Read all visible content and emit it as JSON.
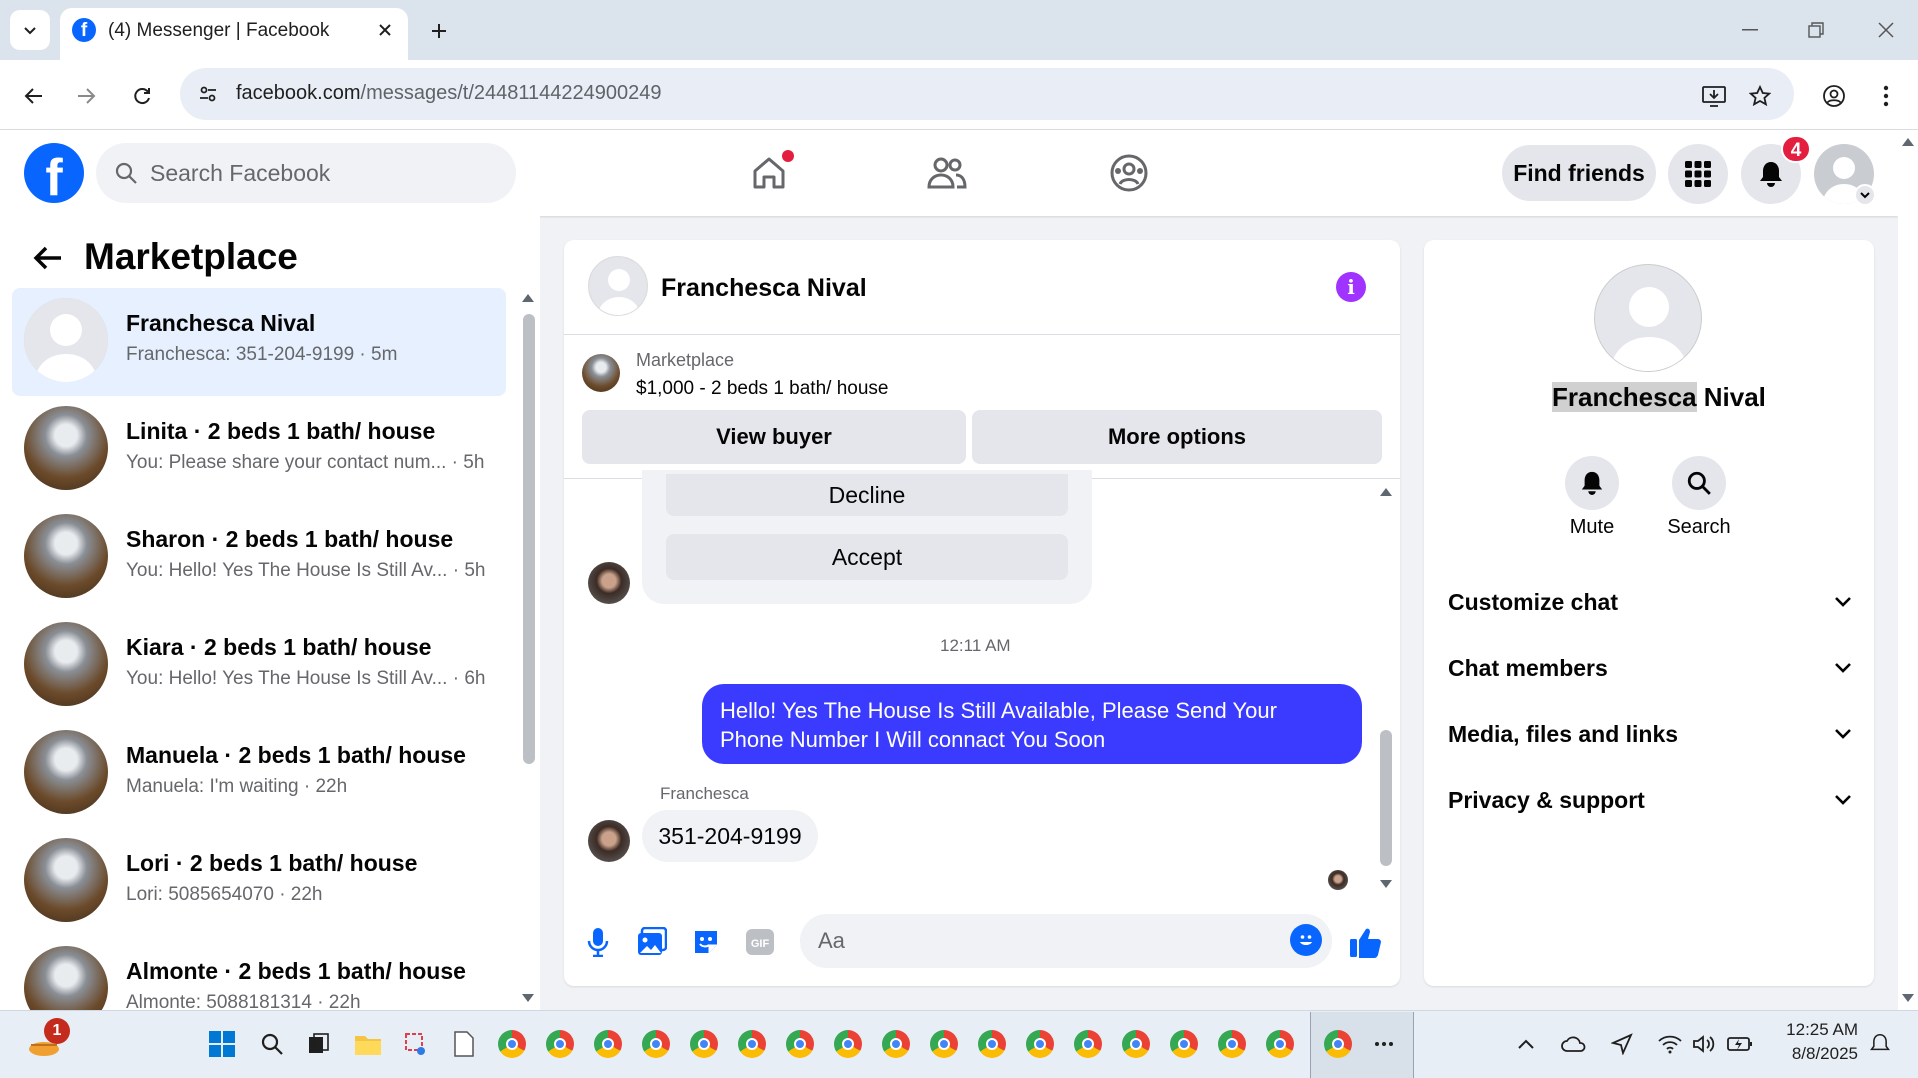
{
  "browser": {
    "tab_title": "(4) Messenger | Facebook",
    "url_domain": "facebook.com",
    "url_path": "/messages/t/24481144224900249"
  },
  "header": {
    "search_placeholder": "Search Facebook",
    "find_friends_label": "Find friends",
    "notification_count": "4"
  },
  "left": {
    "title": "Marketplace",
    "conversations": [
      {
        "name": "Franchesca Nival",
        "preview": "Franchesca: 351-204-9199 · 5m",
        "avatar": "default-avatar"
      },
      {
        "name": "Linita · 2 beds 1 bath/ house",
        "preview": "You: Please share your contact num... · 5h",
        "avatar": "listing-photo"
      },
      {
        "name": "Sharon · 2 beds 1 bath/ house",
        "preview": "You: Hello! Yes The House Is Still Av... · 5h",
        "avatar": "listing-photo"
      },
      {
        "name": "Kiara · 2 beds 1 bath/ house",
        "preview": "You: Hello! Yes The House Is Still Av... · 6h",
        "avatar": "listing-photo"
      },
      {
        "name": "Manuela · 2 beds 1 bath/ house",
        "preview": "Manuela: I'm waiting · 22h",
        "avatar": "listing-photo"
      },
      {
        "name": "Lori · 2 beds 1 bath/ house",
        "preview": "Lori: 5085654070 · 22h",
        "avatar": "listing-photo"
      },
      {
        "name": "Almonte · 2 beds 1 bath/ house",
        "preview": "Almonte: 5088181314 · 22h",
        "avatar": "listing-photo"
      }
    ]
  },
  "chat": {
    "title": "Franchesca Nival",
    "listing_label": "Marketplace",
    "listing_title": "$1,000 - 2 beds 1 bath/ house",
    "view_buyer_label": "View buyer",
    "more_options_label": "More options",
    "decline_label": "Decline",
    "accept_label": "Accept",
    "timestamp": "12:11 AM",
    "outgoing_message": "Hello! Yes The House  Is Still Available, Please Send Your Phone Number I Will connact You Soon",
    "incoming_sender": "Franchesca",
    "incoming_message": "351-204-9199",
    "composer_placeholder": "Aa",
    "accent_color": "#3a3bff"
  },
  "right": {
    "name_first": "Franchesca",
    "name_last": " Nival",
    "mute_label": "Mute",
    "search_label": "Search",
    "sections": [
      "Customize chat",
      "Chat members",
      "Media, files and links",
      "Privacy & support"
    ]
  },
  "taskbar": {
    "badge_count": "1",
    "time": "12:25 AM",
    "date": "8/8/2025"
  }
}
